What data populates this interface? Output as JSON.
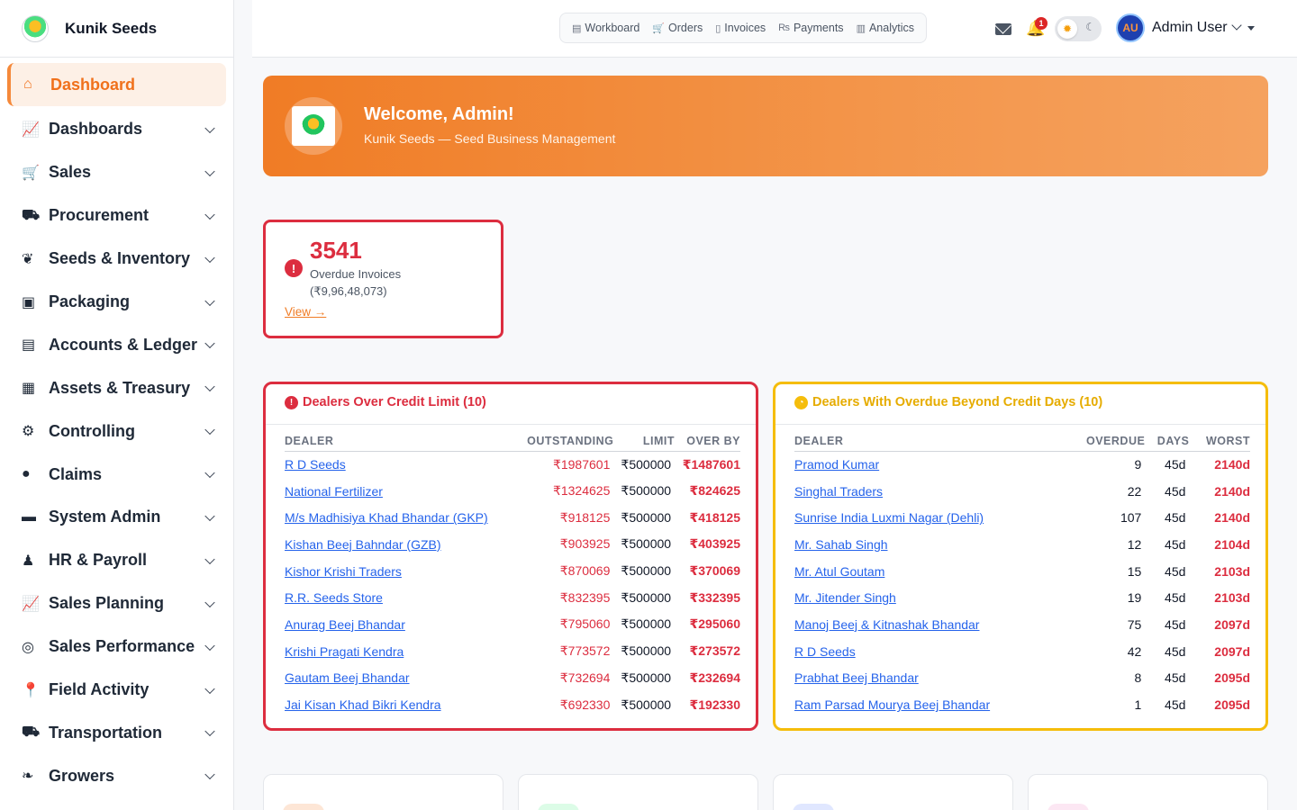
{
  "brand": {
    "name": "Kunik Seeds"
  },
  "sidebar": {
    "items": [
      {
        "label": "Dashboard",
        "icon": "home-icon",
        "glyph": "⌂",
        "active": true
      },
      {
        "label": "Dashboards",
        "icon": "line-chart-icon",
        "glyph": "📈"
      },
      {
        "label": "Sales",
        "icon": "cart-icon",
        "glyph": "🛒"
      },
      {
        "label": "Procurement",
        "icon": "truck-loading-icon",
        "glyph": "⛟"
      },
      {
        "label": "Seeds & Inventory",
        "icon": "seedling-icon",
        "glyph": "❦"
      },
      {
        "label": "Packaging",
        "icon": "box-open-icon",
        "glyph": "▣"
      },
      {
        "label": "Accounts & Ledger",
        "icon": "book-icon",
        "glyph": "▤"
      },
      {
        "label": "Assets & Treasury",
        "icon": "building-icon",
        "glyph": "▦"
      },
      {
        "label": "Controlling",
        "icon": "sitemap-icon",
        "glyph": "⚙"
      },
      {
        "label": "Claims",
        "icon": "alert-circle-icon",
        "glyph": "●"
      },
      {
        "label": "System Admin",
        "icon": "server-icon",
        "glyph": "▬"
      },
      {
        "label": "HR & Payroll",
        "icon": "user-tie-icon",
        "glyph": "♟"
      },
      {
        "label": "Sales Planning",
        "icon": "chart-line-icon",
        "glyph": "📈"
      },
      {
        "label": "Sales Performance",
        "icon": "bullseye-icon",
        "glyph": "◎"
      },
      {
        "label": "Field Activity",
        "icon": "map-pin-icon",
        "glyph": "📍"
      },
      {
        "label": "Transportation",
        "icon": "truck-icon",
        "glyph": "⛟"
      },
      {
        "label": "Growers",
        "icon": "leaf-icon",
        "glyph": "❧"
      }
    ]
  },
  "topbar": {
    "quicknav": [
      {
        "label": "Workboard",
        "icon": "clipboard-icon",
        "glyph": "▤"
      },
      {
        "label": "Orders",
        "icon": "cart-icon",
        "glyph": "🛒"
      },
      {
        "label": "Invoices",
        "icon": "file-icon",
        "glyph": "▯"
      },
      {
        "label": "Payments",
        "icon": "rupee-icon",
        "glyph": "₨"
      },
      {
        "label": "Analytics",
        "icon": "chart-icon",
        "glyph": "▥"
      }
    ],
    "notification_count": "1",
    "user": {
      "initials": "AU",
      "name": "Admin User"
    }
  },
  "welcome": {
    "title": "Welcome, Admin!",
    "subtitle": "Kunik Seeds — Seed Business Management"
  },
  "overdue": {
    "count": "3541",
    "label": "Overdue Invoices",
    "amount": "(₹9,96,48,073)",
    "link": "View →"
  },
  "credit_limit": {
    "title": "Dealers Over Credit Limit (10)",
    "columns": [
      "DEALER",
      "OUTSTANDING",
      "LIMIT",
      "OVER BY"
    ],
    "rows": [
      {
        "dealer": "R D Seeds",
        "outstanding": "₹1987601",
        "limit": "₹500000",
        "over": "₹1487601"
      },
      {
        "dealer": "National Fertilizer",
        "outstanding": "₹1324625",
        "limit": "₹500000",
        "over": "₹824625"
      },
      {
        "dealer": "M/s Madhisiya Khad Bhandar (GKP)",
        "outstanding": "₹918125",
        "limit": "₹500000",
        "over": "₹418125"
      },
      {
        "dealer": "Kishan Beej Bahndar (GZB)",
        "outstanding": "₹903925",
        "limit": "₹500000",
        "over": "₹403925"
      },
      {
        "dealer": "Kishor Krishi Traders",
        "outstanding": "₹870069",
        "limit": "₹500000",
        "over": "₹370069"
      },
      {
        "dealer": "R.R. Seeds Store",
        "outstanding": "₹832395",
        "limit": "₹500000",
        "over": "₹332395"
      },
      {
        "dealer": "Anurag Beej Bhandar",
        "outstanding": "₹795060",
        "limit": "₹500000",
        "over": "₹295060"
      },
      {
        "dealer": "Krishi Pragati Kendra",
        "outstanding": "₹773572",
        "limit": "₹500000",
        "over": "₹273572"
      },
      {
        "dealer": "Gautam Beej Bhandar",
        "outstanding": "₹732694",
        "limit": "₹500000",
        "over": "₹232694"
      },
      {
        "dealer": "Jai Kisan Khad Bikri Kendra",
        "outstanding": "₹692330",
        "limit": "₹500000",
        "over": "₹192330"
      }
    ]
  },
  "overdue_days": {
    "title": "Dealers With Overdue Beyond Credit Days (10)",
    "columns": [
      "DEALER",
      "OVERDUE",
      "DAYS",
      "WORST"
    ],
    "rows": [
      {
        "dealer": "Pramod Kumar",
        "overdue": "9",
        "days": "45d",
        "worst": "2140d"
      },
      {
        "dealer": "Singhal Traders",
        "overdue": "22",
        "days": "45d",
        "worst": "2140d"
      },
      {
        "dealer": "Sunrise India Luxmi Nagar (Dehli)",
        "overdue": "107",
        "days": "45d",
        "worst": "2140d"
      },
      {
        "dealer": "Mr. Sahab Singh",
        "overdue": "12",
        "days": "45d",
        "worst": "2104d"
      },
      {
        "dealer": "Mr. Atul Goutam",
        "overdue": "15",
        "days": "45d",
        "worst": "2103d"
      },
      {
        "dealer": "Mr. Jitender Singh",
        "overdue": "19",
        "days": "45d",
        "worst": "2103d"
      },
      {
        "dealer": "Manoj Beej & Kitnashak Bhandar",
        "overdue": "75",
        "days": "45d",
        "worst": "2097d"
      },
      {
        "dealer": "R D Seeds",
        "overdue": "42",
        "days": "45d",
        "worst": "2097d"
      },
      {
        "dealer": "Prabhat Beej Bhandar",
        "overdue": "8",
        "days": "45d",
        "worst": "2095d"
      },
      {
        "dealer": "Ram Parsad Mourya Beej Bhandar",
        "overdue": "1",
        "days": "45d",
        "worst": "2095d"
      }
    ]
  },
  "colors": {
    "accent": "#f07c25",
    "danger": "#dc2d3f",
    "warning": "#f5bd0b",
    "link": "#2563eb"
  }
}
